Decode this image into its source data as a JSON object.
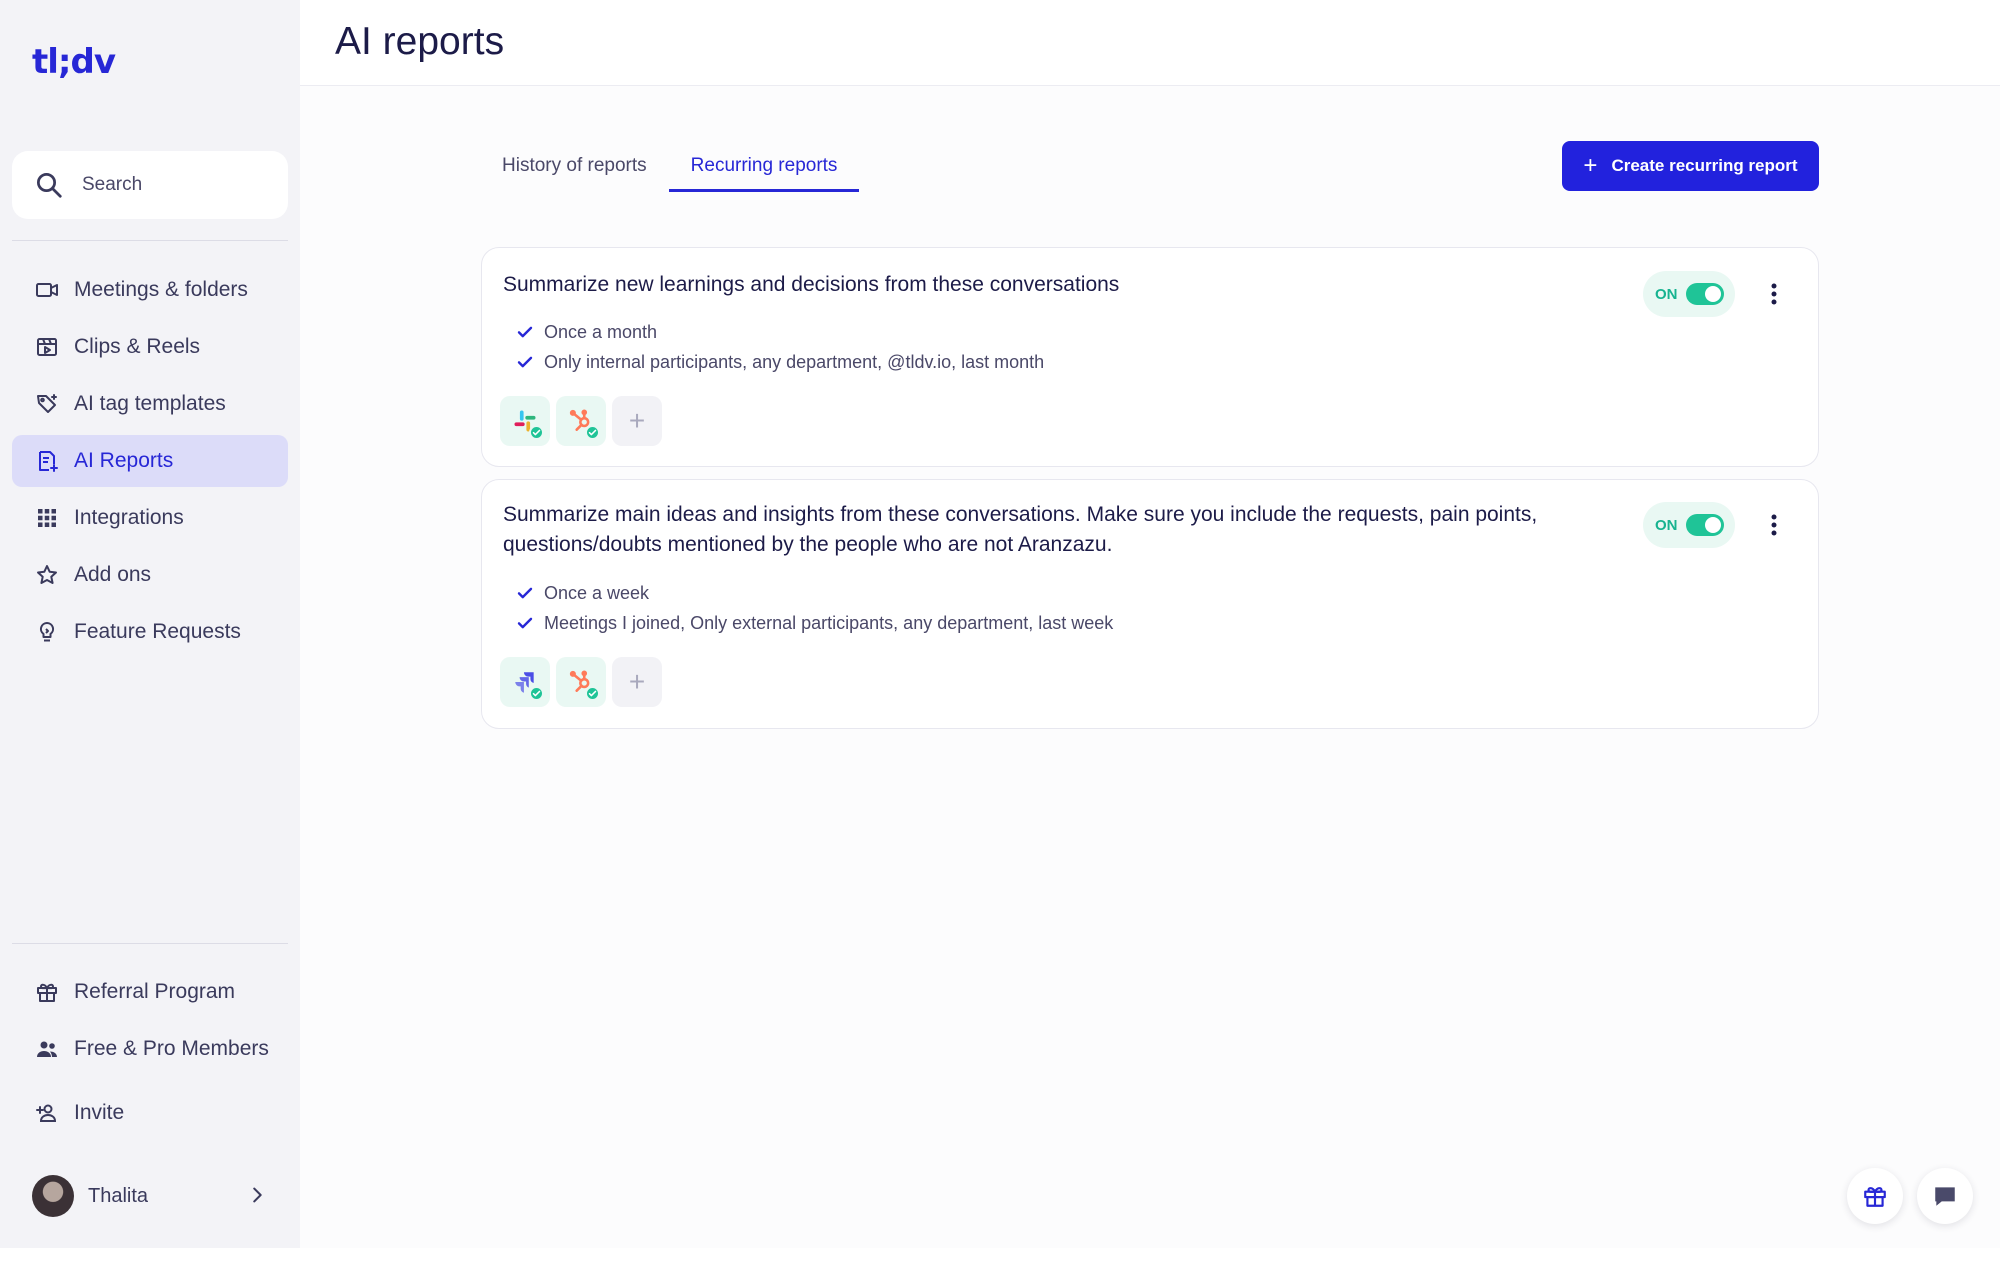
{
  "app": {
    "logo": "tl;dv"
  },
  "search": {
    "label": "Search"
  },
  "sidebar": {
    "nav": [
      {
        "label": "Meetings & folders",
        "icon": "video-camera-icon"
      },
      {
        "label": "Clips & Reels",
        "icon": "clapperboard-icon"
      },
      {
        "label": "AI tag templates",
        "icon": "tag-sparkle-icon"
      },
      {
        "label": "AI Reports",
        "icon": "report-sparkle-icon",
        "active": true
      },
      {
        "label": "Integrations",
        "icon": "grid-dots-icon"
      },
      {
        "label": "Add ons",
        "icon": "star-icon"
      },
      {
        "label": "Feature Requests",
        "icon": "lightbulb-icon"
      }
    ],
    "bottom": [
      {
        "label": "Referral Program",
        "icon": "gift-icon"
      },
      {
        "label": "Free & Pro Members",
        "icon": "people-icon"
      },
      {
        "label": "Invite",
        "icon": "add-person-icon"
      }
    ],
    "user": {
      "name": "Thalita"
    }
  },
  "header": {
    "title": "AI reports"
  },
  "tabs": [
    {
      "label": "History of reports",
      "active": false
    },
    {
      "label": "Recurring reports",
      "active": true
    }
  ],
  "create_button": {
    "label": "Create recurring report"
  },
  "reports": [
    {
      "title": "Summarize new learnings and decisions from these conversations",
      "frequency": "Once a month",
      "filters": "Only internal participants, any department, @tldv.io, last month",
      "toggle": "ON",
      "integrations": [
        "slack-icon",
        "hubspot-icon"
      ]
    },
    {
      "title": "Summarize main ideas and insights from these conversations. Make sure you include the requests, pain points, questions/doubts mentioned by the people who are not Aranzazu.",
      "frequency": "Once a week",
      "filters": "Meetings I joined, Only external participants, any department, last week",
      "toggle": "ON",
      "integrations": [
        "jira-icon",
        "hubspot-icon"
      ]
    }
  ],
  "colors": {
    "brand": "#2727d6",
    "active_nav_bg": "#dcdcf9",
    "toggle_on": "#1fc497",
    "sidebar_bg": "#f3f3f7"
  }
}
